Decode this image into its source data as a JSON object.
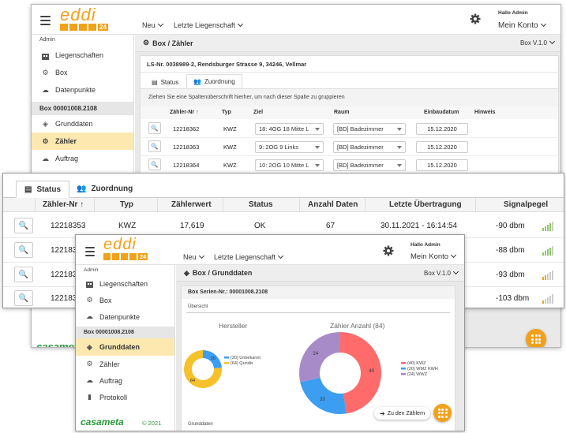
{
  "colors": {
    "accent": "#f2a11b",
    "active_bg": "#fde9b0",
    "kwz": "#ff6b6b",
    "wmz_kwh": "#3b9ef0",
    "wwz": "#a78bc9",
    "unbekannt": "#3b9ef0",
    "qundis": "#f7c12b"
  },
  "brand": {
    "logo_text": "eddi",
    "logo_sub": "24",
    "company": "casameta",
    "year": "© 2021"
  },
  "header": {
    "nav_new": "Neu",
    "nav_last": "Letzte Liegenschaft",
    "greeting": "Hallo Admin",
    "account": "Mein Konto"
  },
  "back": {
    "sidebar": {
      "section": "Admin",
      "items": [
        "Liegenschaften",
        "Box",
        "Datenpunkte"
      ],
      "box_label": "Box 00001008.2108",
      "box_items": [
        "Grunddaten",
        "Zähler",
        "Auftrag"
      ]
    },
    "title": "Box / Zähler",
    "version": "Box V.1.0",
    "address": "LS-Nr. 0038989-2, Rendsburger Strasse 9, 34246, Vellmar",
    "tabs": [
      "Status",
      "Zuordnung"
    ],
    "group_hint": "Ziehen Sie eine Spaltenüberschrift hierher, um nach dieser Spalte zu gruppieren",
    "columns": [
      "Zähler-Nr",
      "Typ",
      "Ziel",
      "Raum",
      "Einbaudatum",
      "Hinweis"
    ],
    "rows": [
      {
        "nr": "12218362",
        "typ": "KWZ",
        "ziel": "18: 4OG 18 Mitte L",
        "raum": "[BD] Badezimmer",
        "datum": "15.12.2020"
      },
      {
        "nr": "12218363",
        "typ": "KWZ",
        "ziel": "9: 2OG 9 Links",
        "raum": "[BD] Badezimmer",
        "datum": "15.12.2020"
      },
      {
        "nr": "12218364",
        "typ": "KWZ",
        "ziel": "10: 2OG 10 Mitte L",
        "raum": "[BD] Badezimmer",
        "datum": "15.12.2020"
      }
    ]
  },
  "mid": {
    "tabs": [
      "Status",
      "Zuordnung"
    ],
    "columns": [
      "Zähler-Nr",
      "Typ",
      "Zählerwert",
      "Status",
      "Anzahl Daten",
      "Letzte Übertragung",
      "Signalpegel"
    ],
    "rows": [
      {
        "nr": "12218353",
        "typ": "KWZ",
        "wert": "17,619",
        "status": "OK",
        "anzahl": "67",
        "letzte": "30.11.2021 - 16:14:54",
        "signal": "-90 dbm",
        "bars": 4,
        "color": "#8fc860"
      },
      {
        "nr": "1221835",
        "signal": "-88 dbm",
        "bars": 4,
        "color": "#8fc860"
      },
      {
        "nr": "1221835",
        "signal": "-93 dbm",
        "bars": 2,
        "color": "#f2a11b"
      },
      {
        "nr": "1221835",
        "signal": "-103 dbm",
        "bars": 1,
        "color": "#f2a11b"
      }
    ]
  },
  "front": {
    "sidebar": {
      "section": "Admin",
      "items": [
        "Liegenschaften",
        "Box",
        "Datenpunkte"
      ],
      "box_label": "Box 00001008.2108",
      "box_items": [
        "Grunddaten",
        "Zähler",
        "Auftrag",
        "Protokoll"
      ]
    },
    "title": "Box / Grunddaten",
    "version": "Box V.1.0",
    "serial": "Box Serien-Nr.: 00001008.2108",
    "overview": "Übersicht",
    "chart1_title": "Hersteller",
    "chart2_title": "Zähler Anzahl (84)",
    "grunddaten": "Grunddaten",
    "to_counters": "Zu den Zählern"
  },
  "chart_data": [
    {
      "type": "pie",
      "title": "Hersteller",
      "series": [
        {
          "name": "(20) Unbekannt",
          "value": 20
        },
        {
          "name": "(64) Qundis",
          "value": 64
        }
      ],
      "data_labels": [
        "20",
        "64"
      ],
      "legend": "right"
    },
    {
      "type": "pie",
      "title": "Zähler Anzahl (84)",
      "series": [
        {
          "name": "(40) KWZ",
          "value": 40
        },
        {
          "name": "(20) WMZ KWH",
          "value": 20
        },
        {
          "name": "(24) WWZ",
          "value": 24
        }
      ],
      "data_labels": [
        "40",
        "20",
        "24"
      ],
      "legend": "right"
    }
  ]
}
